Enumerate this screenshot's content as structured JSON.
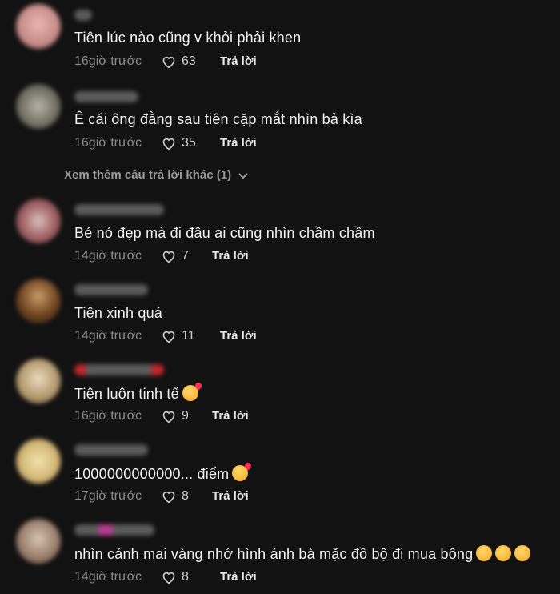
{
  "comments": [
    {
      "text": "Tiên lúc nào cũng v khỏi phải khen",
      "time": "16giờ trước",
      "likes": "63",
      "reply": "Trả lời"
    },
    {
      "text": "Ê cái ông đằng sau tiên cặp mắt nhìn bả kìa",
      "time": "16giờ trước",
      "likes": "35",
      "reply": "Trả lời"
    },
    {
      "text": "Bé nó đẹp mà đi đâu ai cũng nhìn chầm chầm",
      "time": "14giờ trước",
      "likes": "7",
      "reply": "Trả lời"
    },
    {
      "text": "Tiên xinh quá",
      "time": "14giờ trước",
      "likes": "11",
      "reply": "Trả lời"
    },
    {
      "text": "Tiên luôn tinh tế",
      "time": "16giờ trước",
      "likes": "9",
      "reply": "Trả lời"
    },
    {
      "text": "1000000000000... điểm",
      "time": "17giờ trước",
      "likes": "8",
      "reply": "Trả lời"
    },
    {
      "text": "nhìn cảnh mai vàng nhớ hình ảnh bà mặc đồ bộ đi mua bông",
      "time": "14giờ trước",
      "likes": "8",
      "reply": "Trả lời"
    }
  ],
  "view_more": "Xem thêm câu trả lời khác (1)",
  "colors": {
    "background": "#121212",
    "text": "#f2f2f2",
    "meta": "#8b8b8b"
  }
}
